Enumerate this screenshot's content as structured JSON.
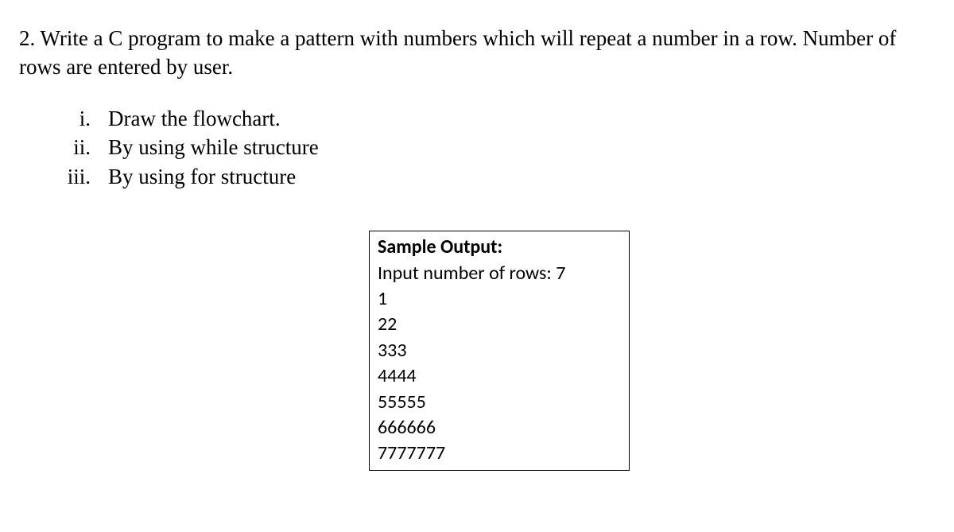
{
  "question": {
    "number": "2.",
    "text": "Write a C program to make a pattern with numbers which will repeat a number in a row. Number of rows are entered by user."
  },
  "subitems": [
    {
      "num": "i.",
      "text": "Draw the flowchart."
    },
    {
      "num": "ii.",
      "text": "By using while structure"
    },
    {
      "num": "iii.",
      "text": "By using for structure"
    }
  ],
  "sample": {
    "title": "Sample Output:",
    "input_line": "Input number of rows: 7",
    "lines": [
      "1",
      "22",
      "333",
      "4444",
      "55555",
      "666666",
      "7777777"
    ]
  }
}
